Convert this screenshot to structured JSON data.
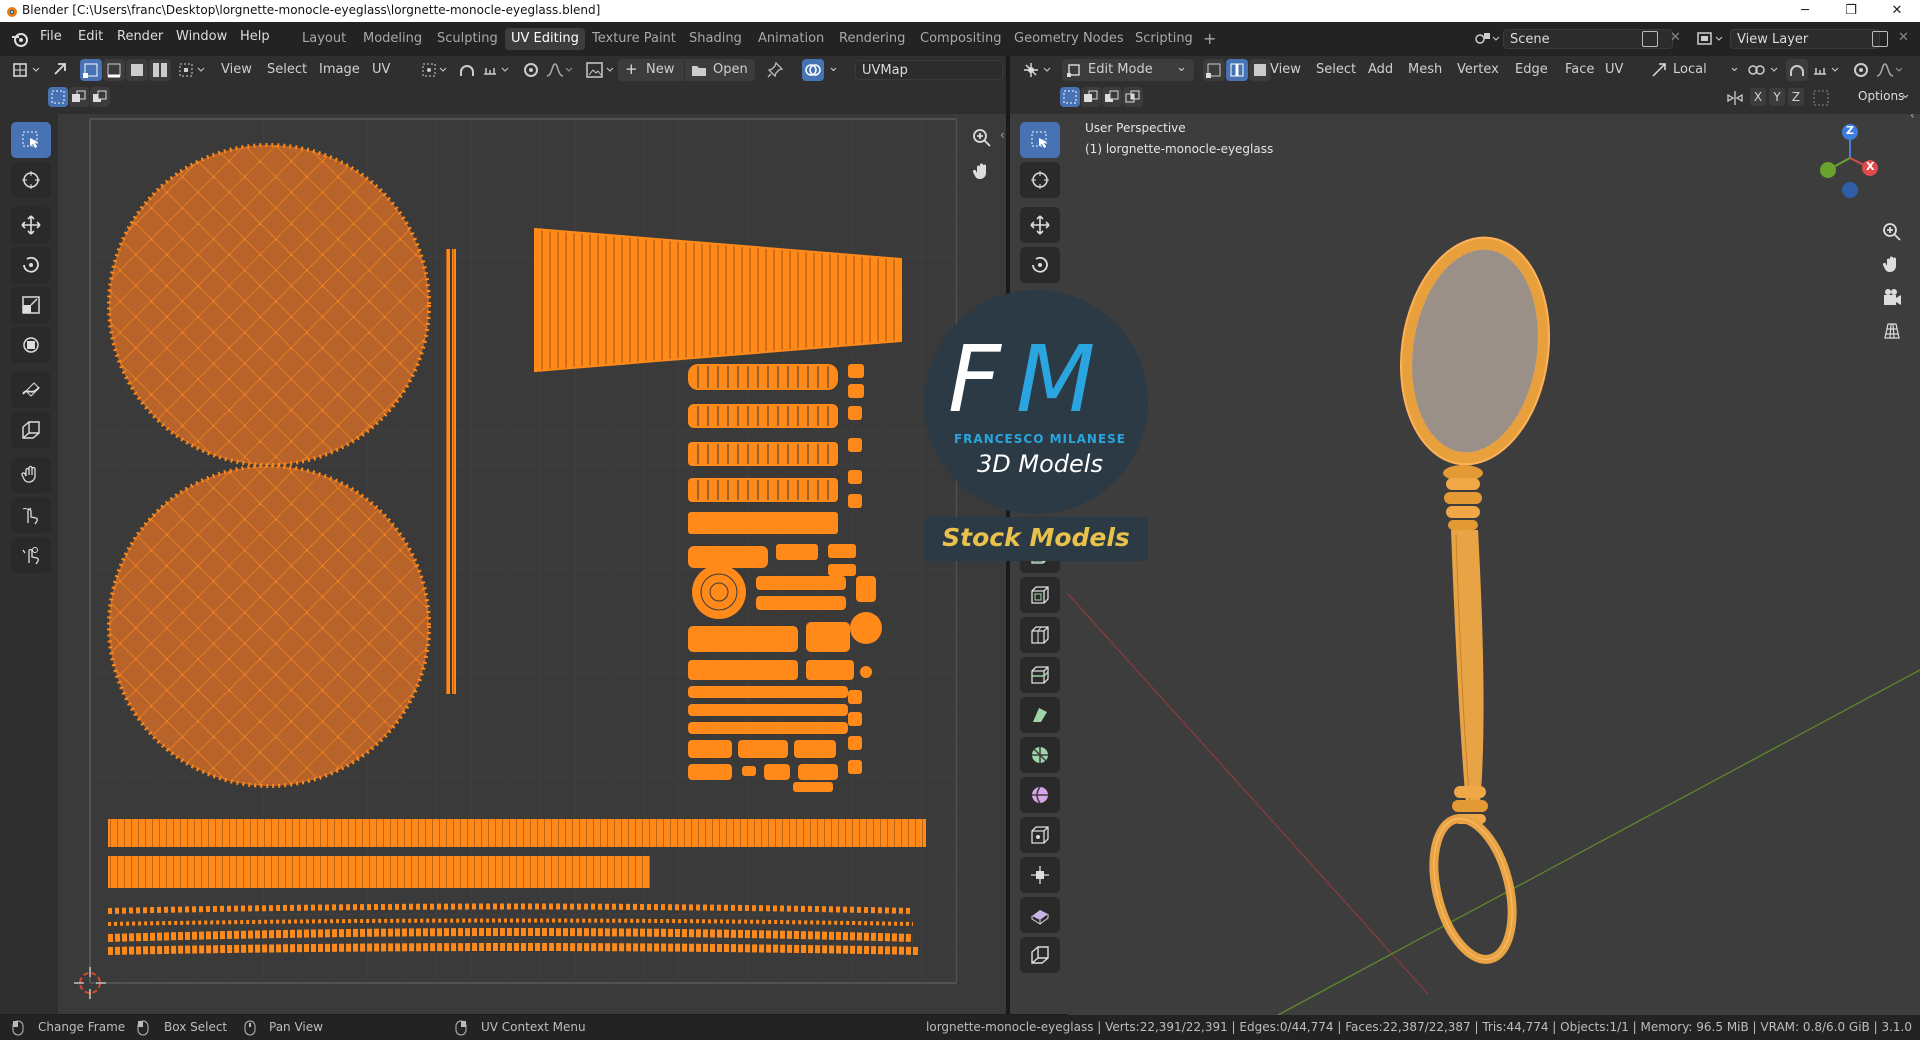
{
  "titlebar": {
    "title": "Blender [C:\\Users\\franc\\Desktop\\lorgnette-monocle-eyeglass\\lorgnette-monocle-eyeglass.blend]",
    "minimize": "─",
    "maximize": "❐",
    "close": "✕"
  },
  "topbar": {
    "menus": [
      "File",
      "Edit",
      "Render",
      "Window",
      "Help"
    ],
    "workspaces": [
      "Layout",
      "Modeling",
      "Sculpting",
      "UV Editing",
      "Texture Paint",
      "Shading",
      "Animation",
      "Rendering",
      "Compositing",
      "Geometry Nodes",
      "Scripting"
    ],
    "active_workspace": "UV Editing",
    "add_workspace": "+",
    "scene": "Scene",
    "view_layer": "View Layer"
  },
  "uv_editor": {
    "menus": [
      "View",
      "Select",
      "Image",
      "UV"
    ],
    "new_label": "New",
    "open_label": "Open",
    "uvmap": "UVMap"
  },
  "viewport": {
    "mode": "Edit Mode",
    "menus": [
      "View",
      "Select",
      "Add",
      "Mesh",
      "Vertex",
      "Edge",
      "Face",
      "UV"
    ],
    "orientation": "Local",
    "axes": [
      "X",
      "Y",
      "Z"
    ],
    "options_label": "Options",
    "perspective": "User Perspective",
    "object_label": "(1) lorgnette-monocle-eyeglass",
    "gizmo_z": "Z",
    "gizmo_x": "X"
  },
  "watermark": {
    "logo": "FM",
    "name": "FRANCESCO MILANESE",
    "subtitle": "3D Models",
    "tagline": "Stock Models"
  },
  "statusbar": {
    "left_items": [
      "Change Frame",
      "Box Select",
      "Pan View",
      "UV Context Menu"
    ],
    "stats": "lorgnette-monocle-eyeglass | Verts:22,391/22,391 | Edges:0/44,774 | Faces:22,387/22,387 | Tris:44,774 | Objects:1/1 | Memory: 96.5 MiB | VRAM: 0.8/6.0 GiB | 3.1.0"
  },
  "colors": {
    "accent": "#4772b3",
    "uv_orange": "#ff8a1a",
    "uv_fill": "#b8632a",
    "gold": "#e8c24a"
  }
}
